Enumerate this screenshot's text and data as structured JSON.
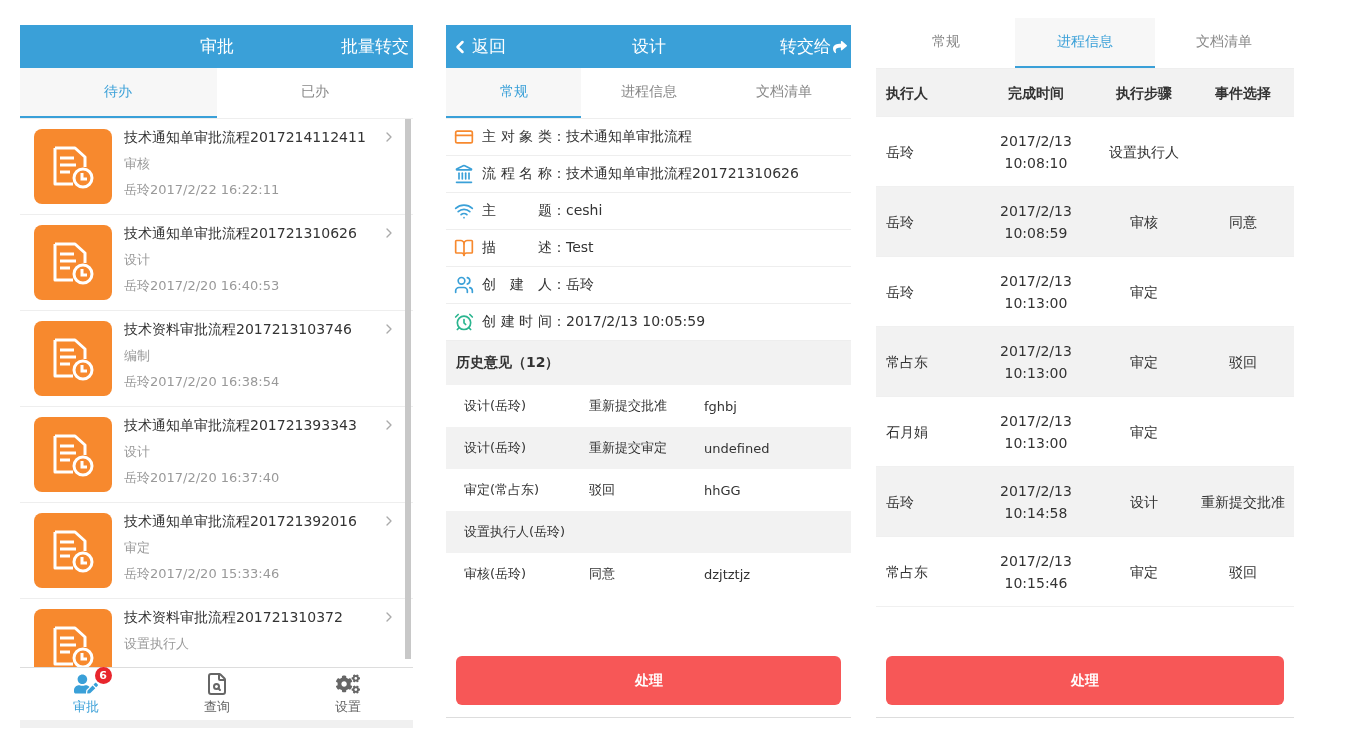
{
  "approval_list": {
    "header": {
      "title": "审批",
      "action": "批量转交"
    },
    "tabs": [
      {
        "label": "待办",
        "selected": true
      },
      {
        "label": "已办",
        "selected": false
      }
    ],
    "items": [
      {
        "title": "技术通知单审批流程2017214112411",
        "step": "审核",
        "time": "岳玲2017/2/22 16:22:11"
      },
      {
        "title": "技术通知单审批流程201721310626",
        "step": "设计",
        "time": "岳玲2017/2/20 16:40:53"
      },
      {
        "title": "技术资料审批流程2017213103746",
        "step": "编制",
        "time": "岳玲2017/2/20 16:38:54"
      },
      {
        "title": "技术通知单审批流程201721393343",
        "step": "设计",
        "time": "岳玲2017/2/20 16:37:40"
      },
      {
        "title": "技术通知单审批流程201721392016",
        "step": "审定",
        "time": "岳玲2017/2/20 15:33:46"
      },
      {
        "title": "技术资料审批流程201721310372",
        "step": "设置执行人"
      }
    ],
    "nav": [
      {
        "label": "审批",
        "selected": true,
        "badge": "6"
      },
      {
        "label": "查询",
        "selected": false
      },
      {
        "label": "设置",
        "selected": false
      }
    ]
  },
  "detail_general": {
    "header": {
      "back": "返回",
      "title": "设计",
      "action": "转交给"
    },
    "tabs": [
      {
        "label": "常规",
        "selected": true
      },
      {
        "label": "进程信息",
        "selected": false
      },
      {
        "label": "文档清单",
        "selected": false
      }
    ],
    "fields": [
      {
        "label": "主对象类",
        "value": "：技术通知单审批流程"
      },
      {
        "label": "流程名称",
        "value": "：技术通知单审批流程201721310626"
      },
      {
        "label": "主题",
        "value": "：ceshi"
      },
      {
        "label": "描述",
        "value": "：Test"
      },
      {
        "label": "创建人",
        "value": "：岳玲"
      },
      {
        "label": "创建时间",
        "value": "：2017/2/13 10:05:59"
      }
    ],
    "history_title": "历史意见（12）",
    "history": [
      {
        "step": "设计(岳玲)",
        "action": "重新提交批准",
        "comment": "fghbj"
      },
      {
        "step": "设计(岳玲)",
        "action": "重新提交审定",
        "comment": "undefined"
      },
      {
        "step": "审定(常占东)",
        "action": "驳回",
        "comment": "hhGG"
      },
      {
        "step": "设置执行人(岳玲)"
      },
      {
        "step": "审核(岳玲)",
        "action": "同意",
        "comment": "dzjtztjz"
      }
    ],
    "button": "处理"
  },
  "detail_progress": {
    "tabs": [
      {
        "label": "常规",
        "selected": false
      },
      {
        "label": "进程信息",
        "selected": true
      },
      {
        "label": "文档清单",
        "selected": false
      }
    ],
    "columns": [
      "执行人",
      "完成时间",
      "执行步骤",
      "事件选择"
    ],
    "rows": [
      [
        "岳玲",
        "2017/2/13 10:08:10",
        "设置执行人",
        ""
      ],
      [
        "岳玲",
        "2017/2/13 10:08:59",
        "审核",
        "同意"
      ],
      [
        "岳玲",
        "2017/2/13 10:13:00",
        "审定",
        ""
      ],
      [
        "常占东",
        "2017/2/13 10:13:00",
        "审定",
        "驳回"
      ],
      [
        "石月娟",
        "2017/2/13 10:13:00",
        "审定",
        ""
      ],
      [
        "岳玲",
        "2017/2/13 10:14:58",
        "设计",
        "重新提交批准"
      ],
      [
        "常占东",
        "2017/2/13 10:15:46",
        "审定",
        "驳回"
      ]
    ],
    "button": "处理"
  }
}
